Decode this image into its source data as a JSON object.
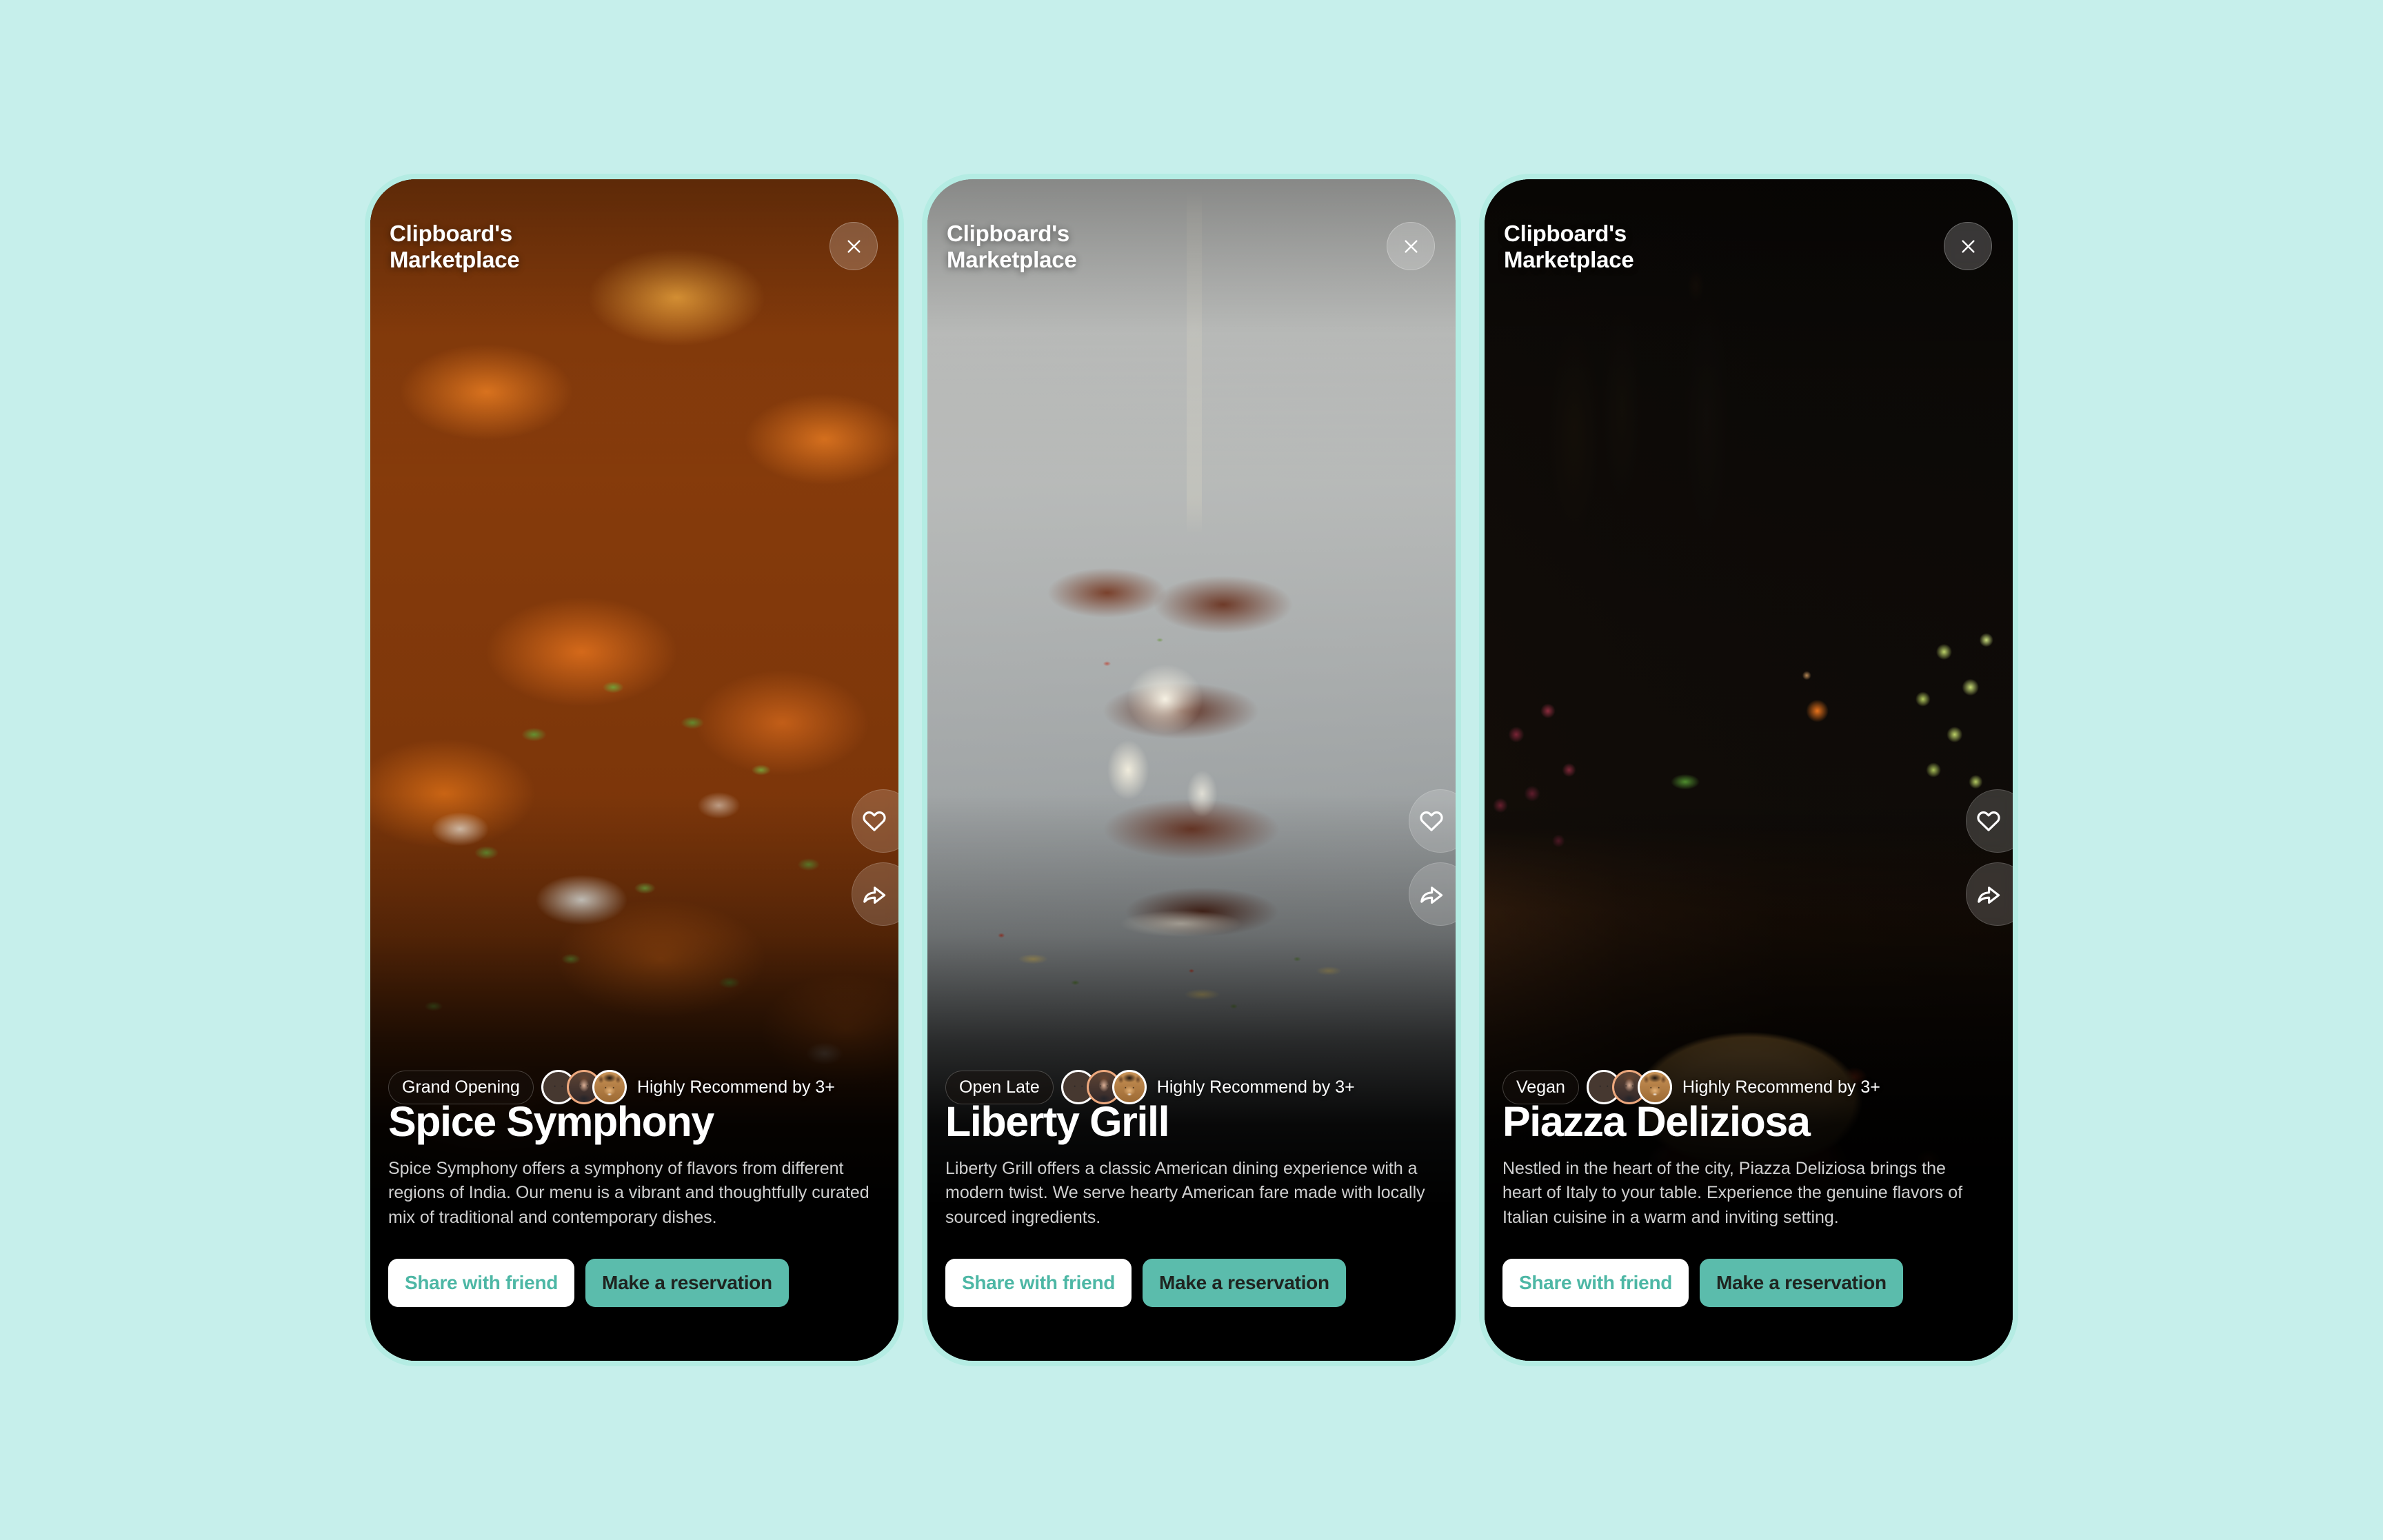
{
  "page": {
    "background_color": "#c6efeb",
    "frame_color": "#b4ece3",
    "accent_color": "#5bbcac",
    "share_text_color": "#4db7a5"
  },
  "brand": {
    "line1": "Clipboard's",
    "line2": "Marketplace"
  },
  "icons": {
    "close": "close-icon",
    "favorite": "heart-icon",
    "share": "share-arrow-icon"
  },
  "common": {
    "recommend_label": "Highly Recommend by 3+",
    "share_label": "Share with friend",
    "reserve_label": "Make a reservation",
    "avatars": [
      {
        "name": "avatar-man",
        "kind": "man",
        "ring": "white"
      },
      {
        "name": "avatar-woman",
        "kind": "woman",
        "ring": "peach"
      },
      {
        "name": "avatar-dog",
        "kind": "dog",
        "ring": "white"
      }
    ]
  },
  "cards": [
    {
      "id": "spice-symphony",
      "tag": "Grand Opening",
      "title": "Spice Symphony",
      "description": "Spice Symphony offers a symphony of flavors from different regions of India. Our menu is a vibrant and thoughtfully curated mix of traditional and contemporary dishes.",
      "recommend": "Highly Recommend by 3+",
      "share_label": "Share with friend",
      "reserve_label": "Make a reservation",
      "photo": "indian-curry-candlelit"
    },
    {
      "id": "liberty-grill",
      "tag": "Open Late",
      "title": "Liberty Grill",
      "description": "Liberty Grill offers a classic American dining experience with a modern twist. We serve hearty American fare made with locally sourced ingredients.",
      "recommend": "Highly Recommend by 3+",
      "share_label": "Share with friend",
      "reserve_label": "Make a reservation",
      "photo": "steak-with-cream-sauce"
    },
    {
      "id": "piazza-deliziosa",
      "tag": "Vegan",
      "title": "Piazza Deliziosa",
      "description": "Nestled in the heart of the city, Piazza Deliziosa brings the heart of Italy to your table. Experience the genuine flavors of Italian cuisine in a warm and inviting setting.",
      "recommend": "Highly Recommend by 3+",
      "share_label": "Share with friend",
      "reserve_label": "Make a reservation",
      "photo": "margherita-pizza-rustic-table"
    }
  ]
}
